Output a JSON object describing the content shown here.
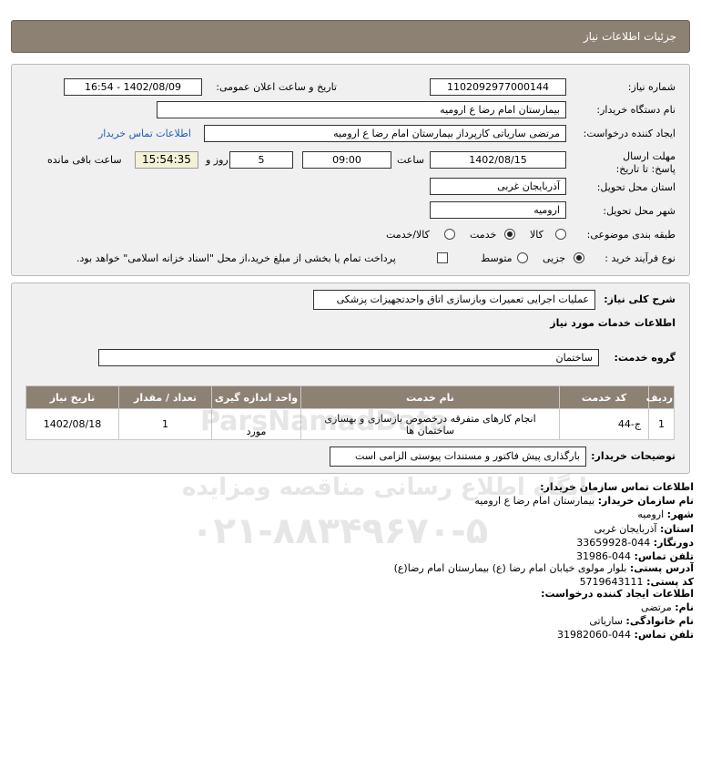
{
  "header": {
    "title": "جزئیات اطلاعات نیاز"
  },
  "form": {
    "need_number_label": "شماره نیاز:",
    "need_number": "1102092977000144",
    "announce_label": "تاریخ و ساعت اعلان عمومی:",
    "announce_value": "1402/08/09 - 16:54",
    "buyer_org_label": "نام دستگاه خریدار:",
    "buyer_org": "بیمارستان امام رضا  ع  ارومیه",
    "creator_label": "ایجاد کننده درخواست:",
    "creator": "مرتضی ساریاتی کارپرداز بیمارستان امام رضا  ع  ارومیه",
    "buyer_contact_link": "اطلاعات تماس خریدار",
    "deadline_label": "مهلت ارسال پاسخ: تا تاریخ:",
    "deadline_date": "1402/08/15",
    "hour_label": "ساعت",
    "deadline_time": "09:00",
    "days_value": "5",
    "days_label": "روز و",
    "remaining_time": "15:54:35",
    "remaining_label": "ساعت باقی مانده",
    "province_label": "استان محل تحویل:",
    "province": "آذربایجان غربی",
    "city_label": "شهر محل تحویل:",
    "city": "ارومیه",
    "category_label": "طبقه بندی موضوعی:",
    "category_options": [
      "کالا",
      "خدمت",
      "کالا/خدمت"
    ],
    "category_selected": "خدمت",
    "process_label": "نوع فرآیند خرید :",
    "process_options": [
      "جزیی",
      "متوسط"
    ],
    "process_selected": "جزیی",
    "payment_note": "پرداخت تمام یا بخشی از مبلغ خرید،از محل \"اسناد خزانه اسلامی\" خواهد بود."
  },
  "need": {
    "summary_label": "شرح کلی نیاز:",
    "summary": "عملیات اجرایی تعمیرات وبازسازی اتاق واحدتجهیزات پزشکی",
    "services_title": "اطلاعات خدمات مورد نیاز",
    "service_group_label": "گروه خدمت:",
    "service_group": "ساختمان"
  },
  "table": {
    "headers": [
      "ردیف",
      "کد خدمت",
      "نام خدمت",
      "واحد اندازه گیری",
      "تعداد / مقدار",
      "تاریخ نیاز"
    ],
    "rows": [
      [
        "1",
        "ج-44",
        "انجام کارهای متفرقه درخصوص بازسازی و بهسازی ساختمان ها",
        "مورد",
        "1",
        "1402/08/18"
      ]
    ]
  },
  "buyer_notes": {
    "label": "توضیحات خریدار:",
    "text": "بارگذاری پیش فاکتور و مستندات پیوستی الزامی است"
  },
  "contact": {
    "title": "اطلاعات تماس سازمان خریدار:",
    "org_label": "نام سازمان خریدار:",
    "org": "بیمارستان امام رضا ع ارومیه",
    "city_label": "شهر:",
    "city": "ارومیه",
    "province_label": "استان:",
    "province": "آذربایجان غربی",
    "fax_label": "دورنگار:",
    "fax": "044-33659928",
    "phone_label": "تلفن تماس:",
    "phone": "044-31986",
    "address_label": "آدرس پستی:",
    "address": "بلوار مولوی خیابان امام رضا (ع) بیمارستان امام رضا(ع)",
    "postal_label": "کد پستی:",
    "postal": "5719643111",
    "creator_title": "اطلاعات ایجاد کننده درخواست:",
    "first_name_label": "نام:",
    "first_name": "مرتضی",
    "last_name_label": "نام خانوادگی:",
    "last_name": "ساریاتی",
    "creator_phone_label": "تلفن تماس:",
    "creator_phone": "044-31982060"
  },
  "watermark": {
    "brand": "ParsNamadData",
    "line1": "پایگاه اطلاع رسانی مناقصه ومزایده",
    "phone": "۰۲۱-۸۸۳۴۹۶۷۰-۵"
  },
  "colors": {
    "header_bg": "#8d8173",
    "link": "#1d5dbe",
    "panel_bg": "#f0f0f0"
  }
}
